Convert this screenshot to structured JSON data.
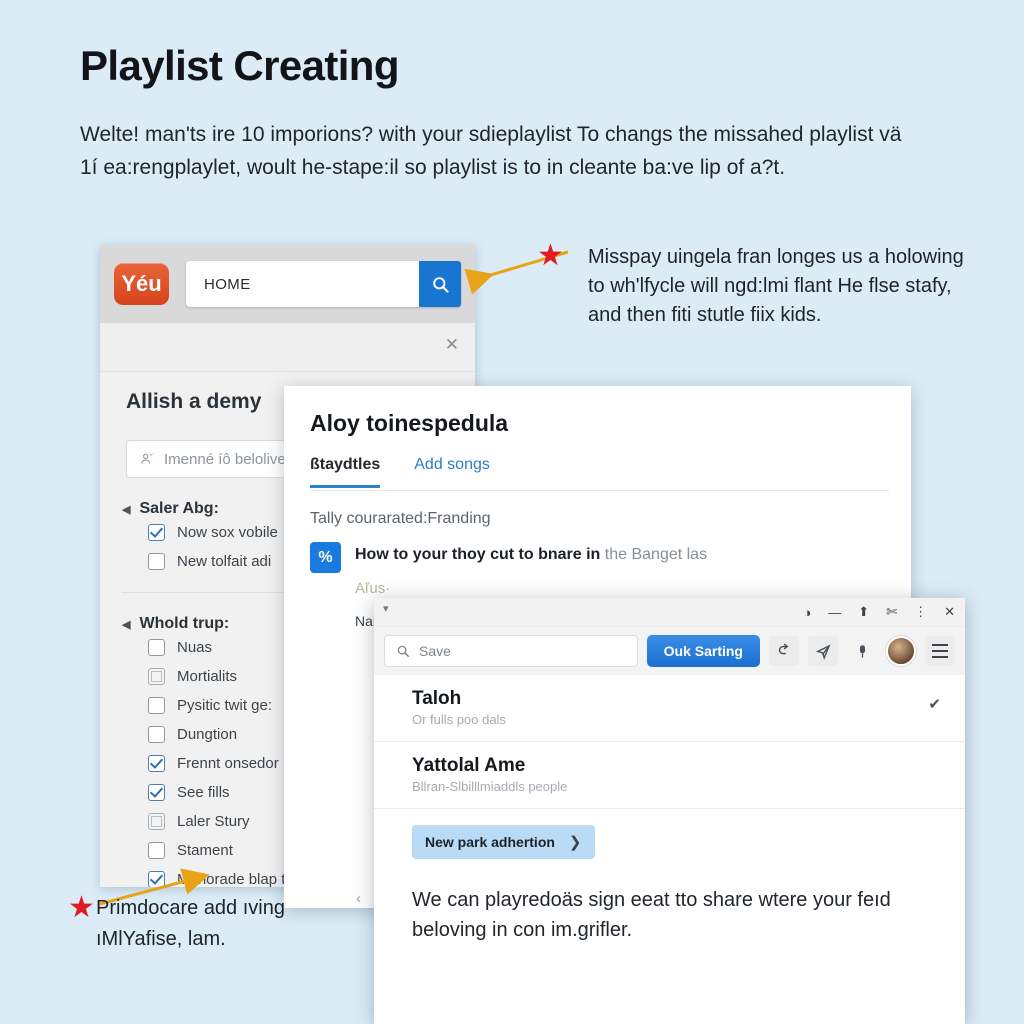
{
  "article": {
    "title": "Playlist Creating",
    "paragraph": "Welte! man'ts ire 10 imporions? with your sdieplaylist To changs the missahed playlist vä 1í ea:rengplaylet, woult he-stape:il so playlist is to in cleante ba:ve lip of a?t."
  },
  "annotations": {
    "star_icon": "star-icon",
    "top": {
      "text": "Misspay uingela fran longes us a holowing to wh'lfycle will ngd:lmi flant He flse stafy, and then fiti stutle fiix kids."
    },
    "bottom": {
      "text": "Primdocare add ıving ıMlYafise, lam."
    }
  },
  "window_search": {
    "logo_label": "Yéu",
    "search_value": "HOME",
    "search_icon": "search-icon",
    "close_icon": "close-icon",
    "close_label": "✕",
    "panel": {
      "title": "Allish a demy",
      "input_placeholder": "Imenné íô belolive",
      "input_icon": "contact-icon",
      "groups": [
        {
          "label": "Saler Abg:",
          "caret": "◀",
          "options": [
            {
              "label": "Now sox vobile",
              "state": "checked"
            },
            {
              "label": "New tolfait adi",
              "state": "unchecked"
            }
          ]
        },
        {
          "label": "Whold trup:",
          "caret": "◀",
          "options": [
            {
              "label": "Nuas",
              "state": "unchecked"
            },
            {
              "label": "Mortialits",
              "state": "mixed"
            },
            {
              "label": "Pysitic twit ge:",
              "state": "unchecked"
            },
            {
              "label": "Dungtion",
              "state": "unchecked"
            },
            {
              "label": "Frennt onsedor",
              "state": "checked"
            },
            {
              "label": "See fills",
              "state": "checked"
            },
            {
              "label": "Laler Stury",
              "state": "mixed"
            },
            {
              "label": "Stament",
              "state": "unchecked"
            },
            {
              "label": "Menorade blap to:",
              "state": "checked"
            }
          ]
        }
      ]
    }
  },
  "window_playlist": {
    "title": "Aloy toinespedula",
    "tabs": [
      {
        "label": "ßtaydtles",
        "active": true
      },
      {
        "label": "Add songs",
        "active": false
      }
    ],
    "section_label": "Tally courarated:Franding",
    "row": {
      "badge": "%",
      "bold_text": "How to your thoy cut to bnare in",
      "rest_text": "the Banget las",
      "sub_text": "Aľus·"
    },
    "name_field_label": "Nar",
    "name_field_caret": "▾",
    "bottom_caret": "‹"
  },
  "window_app": {
    "chrome": {
      "left_caret": "▾",
      "icons": [
        "shield-icon",
        "minimize-icon",
        "upload-icon",
        "scissors-icon",
        "kebab-menu-icon",
        "close-icon"
      ],
      "glyphs": [
        "◑",
        "—",
        "⬆",
        "✄",
        "⋮",
        "✕"
      ]
    },
    "toolbar": {
      "search_placeholder": "Save",
      "search_icon": "search-icon",
      "primary_button": "Ouk Sarting",
      "icons": [
        "share-icon",
        "send-icon",
        "pin-icon",
        "avatar",
        "hamburger-menu-icon"
      ]
    },
    "list": [
      {
        "title": "Taloh",
        "subtitle": "Or fulls poo dals",
        "tick": "✔"
      },
      {
        "title": "Yattolal Ame",
        "subtitle": "Bllran-Slbilllmiaddls people",
        "tick": ""
      }
    ],
    "chip": {
      "label": "New park adhertion",
      "arrow": "❯"
    },
    "paragraph": "We can playredoäs sign eeat tto share wtere your feıd beloving in con im.grifler."
  },
  "colors": {
    "page_background": "#dcecf7",
    "brand_orange": "#d6441c",
    "accent_blue": "#1876d2",
    "star_red": "#e01b24",
    "arrow_gold": "#e8a317"
  }
}
